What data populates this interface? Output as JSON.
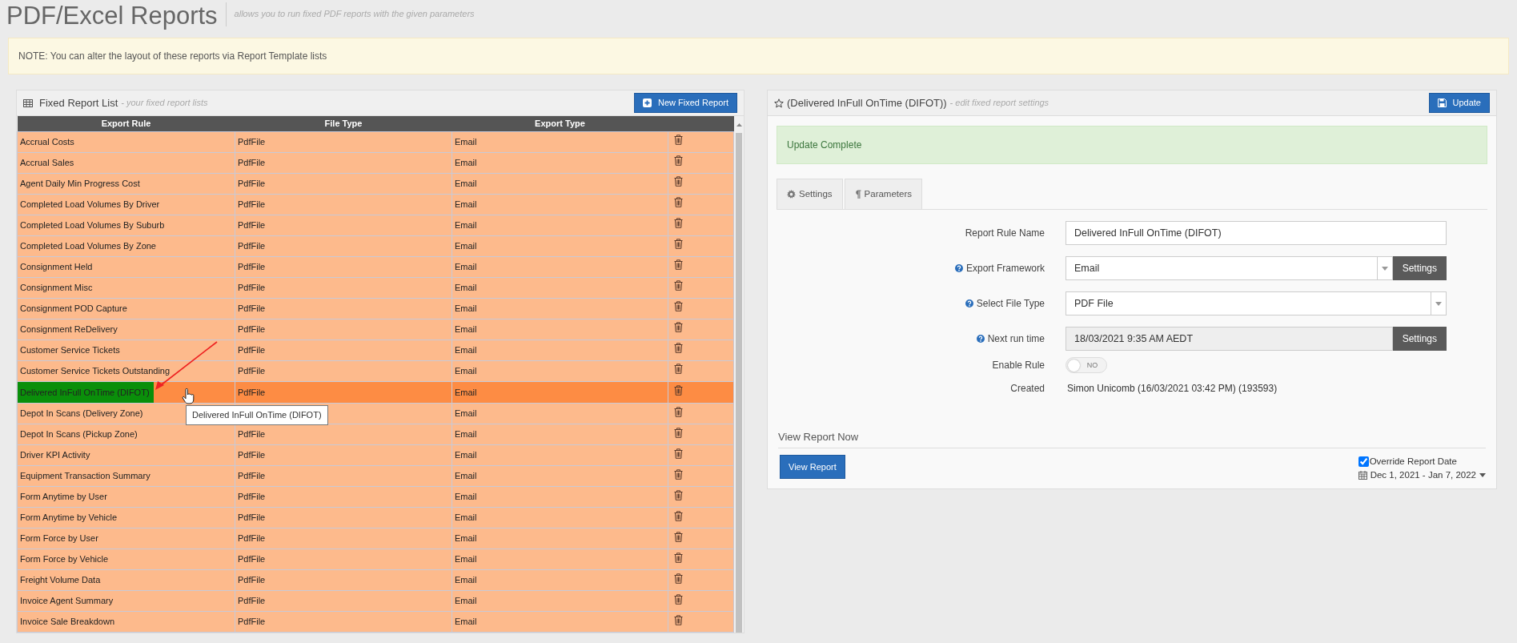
{
  "page": {
    "title": "PDF/Excel Reports",
    "subtitle": "allows you to run fixed PDF reports with the given parameters"
  },
  "note": "NOTE: You can alter the layout of these reports via Report Template lists",
  "report_list": {
    "title": "Fixed Report List",
    "subtitle": "- your fixed report lists",
    "new_button": "New Fixed Report",
    "columns": [
      "Export Rule",
      "File Type",
      "Export Type"
    ],
    "rows": [
      {
        "export_rule": "Accrual Costs",
        "file_type": "PdfFile",
        "export_type": "Email",
        "selected": false
      },
      {
        "export_rule": "Accrual Sales",
        "file_type": "PdfFile",
        "export_type": "Email",
        "selected": false
      },
      {
        "export_rule": "Agent Daily Min Progress Cost",
        "file_type": "PdfFile",
        "export_type": "Email",
        "selected": false
      },
      {
        "export_rule": "Completed Load Volumes By Driver",
        "file_type": "PdfFile",
        "export_type": "Email",
        "selected": false
      },
      {
        "export_rule": "Completed Load Volumes By Suburb",
        "file_type": "PdfFile",
        "export_type": "Email",
        "selected": false
      },
      {
        "export_rule": "Completed Load Volumes By Zone",
        "file_type": "PdfFile",
        "export_type": "Email",
        "selected": false
      },
      {
        "export_rule": "Consignment Held",
        "file_type": "PdfFile",
        "export_type": "Email",
        "selected": false
      },
      {
        "export_rule": "Consignment Misc",
        "file_type": "PdfFile",
        "export_type": "Email",
        "selected": false
      },
      {
        "export_rule": "Consignment POD Capture",
        "file_type": "PdfFile",
        "export_type": "Email",
        "selected": false
      },
      {
        "export_rule": "Consignment ReDelivery",
        "file_type": "PdfFile",
        "export_type": "Email",
        "selected": false
      },
      {
        "export_rule": "Customer Service Tickets",
        "file_type": "PdfFile",
        "export_type": "Email",
        "selected": false
      },
      {
        "export_rule": "Customer Service Tickets Outstanding",
        "file_type": "PdfFile",
        "export_type": "Email",
        "selected": false
      },
      {
        "export_rule": "Delivered InFull OnTime (DIFOT)",
        "file_type": "PdfFile",
        "export_type": "Email",
        "selected": true
      },
      {
        "export_rule": "Depot In Scans (Delivery Zone)",
        "export_type": "Email",
        "selected": false
      },
      {
        "export_rule": "Depot In Scans (Pickup Zone)",
        "file_type": "PdfFile",
        "export_type": "Email",
        "selected": false
      },
      {
        "export_rule": "Driver KPI Activity",
        "file_type": "PdfFile",
        "export_type": "Email",
        "selected": false
      },
      {
        "export_rule": "Equipment Transaction Summary",
        "file_type": "PdfFile",
        "export_type": "Email",
        "selected": false
      },
      {
        "export_rule": "Form Anytime by User",
        "file_type": "PdfFile",
        "export_type": "Email",
        "selected": false
      },
      {
        "export_rule": "Form Anytime by Vehicle",
        "file_type": "PdfFile",
        "export_type": "Email",
        "selected": false
      },
      {
        "export_rule": "Form Force by User",
        "file_type": "PdfFile",
        "export_type": "Email",
        "selected": false
      },
      {
        "export_rule": "Form Force by Vehicle",
        "file_type": "PdfFile",
        "export_type": "Email",
        "selected": false
      },
      {
        "export_rule": "Freight Volume Data",
        "file_type": "PdfFile",
        "export_type": "Email",
        "selected": false
      },
      {
        "export_rule": "Invoice Agent Summary",
        "file_type": "PdfFile",
        "export_type": "Email",
        "selected": false
      },
      {
        "export_rule": "Invoice Sale Breakdown",
        "file_type": "PdfFile",
        "export_type": "Email",
        "selected": false
      }
    ],
    "tooltip": "Delivered InFull OnTime (DIFOT)"
  },
  "detail": {
    "title": "(Delivered InFull OnTime (DIFOT))",
    "subtitle": "- edit fixed report settings",
    "update_button": "Update",
    "alert": "Update Complete",
    "tabs": [
      {
        "label": "Settings",
        "selected": false
      },
      {
        "label": "Parameters",
        "selected": false
      }
    ],
    "fields": [
      {
        "kind": "text",
        "label": "Report Rule Name",
        "help": false,
        "value": "Delivered InFull OnTime (DIFOT)"
      },
      {
        "kind": "select",
        "label": "Export Framework",
        "help": true,
        "value": "Email",
        "button": "Settings"
      },
      {
        "kind": "select",
        "label": "Select File Type",
        "help": true,
        "value": "PDF File"
      },
      {
        "kind": "readonly",
        "label": "Next run time",
        "help": true,
        "value": "18/03/2021 9:35 AM AEDT",
        "button": "Settings"
      },
      {
        "kind": "toggle",
        "label": "Enable Rule",
        "help": false,
        "on": false,
        "text": "NO"
      },
      {
        "kind": "static",
        "label": "Created",
        "help": false,
        "value": "Simon Unicomb (16/03/2021 03:42 PM) (193593)"
      }
    ],
    "view": {
      "heading": "View Report Now",
      "button": "View Report",
      "override": {
        "label": "Override Report Date",
        "checked": true
      },
      "date_range": "Dec 1, 2021 - Jan 7, 2022"
    }
  }
}
